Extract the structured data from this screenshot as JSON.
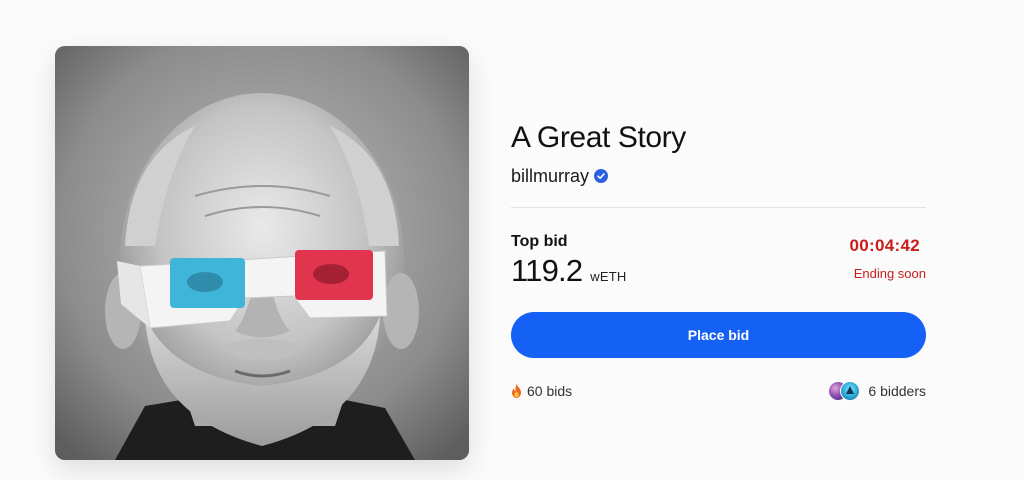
{
  "artwork": {
    "alt_subject": "portrait-with-3d-glasses"
  },
  "item": {
    "title": "A Great Story",
    "creator": "billmurray",
    "verified_icon": "verified-check-icon"
  },
  "auction": {
    "top_bid_label": "Top bid",
    "top_bid_amount": "119.2",
    "currency": "wETH",
    "countdown": "00:04:42",
    "status": "Ending soon"
  },
  "actions": {
    "place_bid_label": "Place bid"
  },
  "stats": {
    "bids_icon": "fire-icon",
    "bids_text": "60 bids",
    "bidders_text": "6 bidders"
  },
  "colors": {
    "accent": "#1560f5",
    "urgent": "#c91c1c",
    "verified": "#2a5fe0"
  }
}
